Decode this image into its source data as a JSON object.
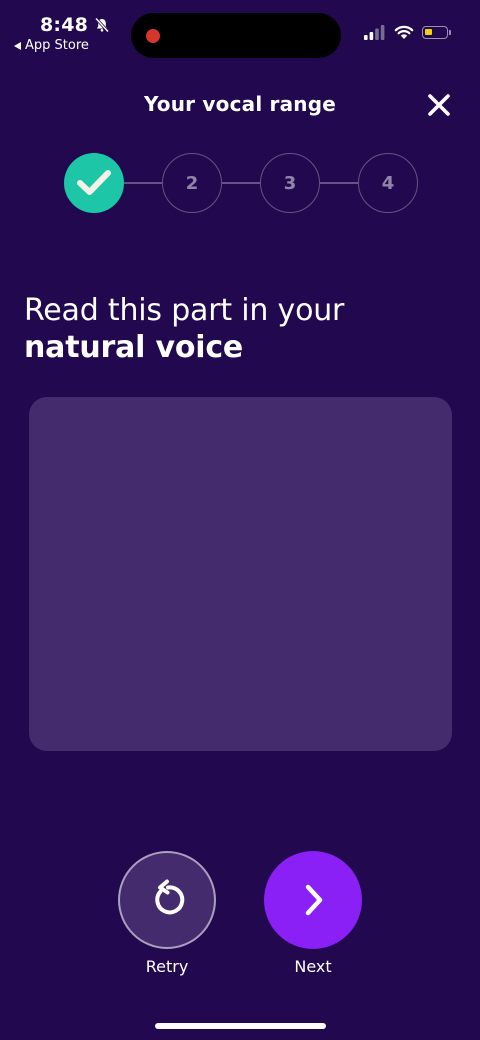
{
  "status_bar": {
    "time": "8:48",
    "back_label": "App Store"
  },
  "header": {
    "title": "Your vocal range"
  },
  "stepper": {
    "steps": [
      {
        "label": "",
        "state": "done"
      },
      {
        "label": "2",
        "state": "pending"
      },
      {
        "label": "3",
        "state": "pending"
      },
      {
        "label": "4",
        "state": "pending"
      }
    ]
  },
  "prompt": {
    "line1": "Read this part in your",
    "line2": "natural voice"
  },
  "actions": {
    "retry_label": "Retry",
    "next_label": "Next"
  },
  "colors": {
    "background": "#22094f",
    "panel": "#442b6d",
    "step_done": "#1cc6a6",
    "next_button": "#8a1ff6",
    "record_dot": "#d7372a",
    "battery": "#f5d20e"
  }
}
